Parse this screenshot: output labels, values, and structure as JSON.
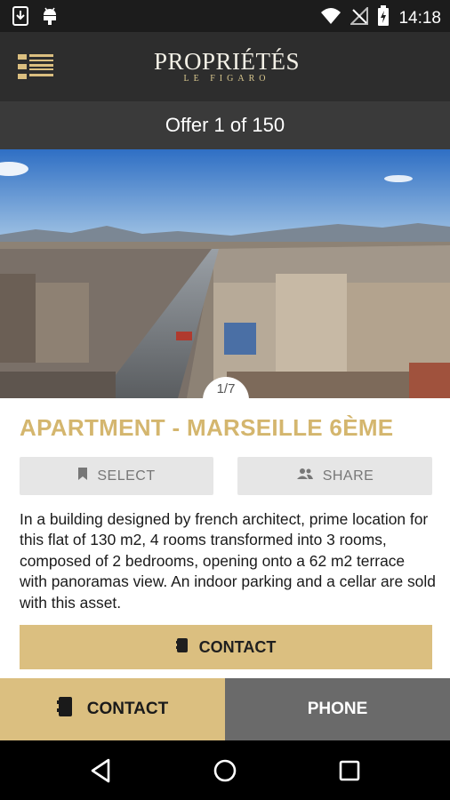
{
  "status_bar": {
    "time": "14:18",
    "icons": [
      "download-icon",
      "android-icon",
      "wifi-icon",
      "no-signal-icon",
      "battery-charging-icon"
    ]
  },
  "app_bar": {
    "logo_main": "PROPRIÉTÉS",
    "logo_sub": "LE FIGARO",
    "menu_icon": "list-menu-icon",
    "accent_color": "#dbbf80"
  },
  "offer_bar": {
    "text": "Offer 1 of 150"
  },
  "listing": {
    "photo_counter": "1/7",
    "title": "APARTMENT - MARSEILLE 6ÈME",
    "select_label": "SELECT",
    "share_label": "SHARE",
    "description": "In a building designed by french architect, prime location for this flat of 130 m2, 4 rooms transformed into  3 rooms, composed of 2 bedrooms, opening onto a 62 m2 terrace with panoramas view. An indoor parking and a cellar are sold with this asset.",
    "contact_label": "CONTACT"
  },
  "bottom_bar": {
    "contact_label": "CONTACT",
    "phone_label": "PHONE"
  },
  "nav_bar": {
    "icons": [
      "back-icon",
      "home-icon",
      "recents-icon"
    ]
  }
}
